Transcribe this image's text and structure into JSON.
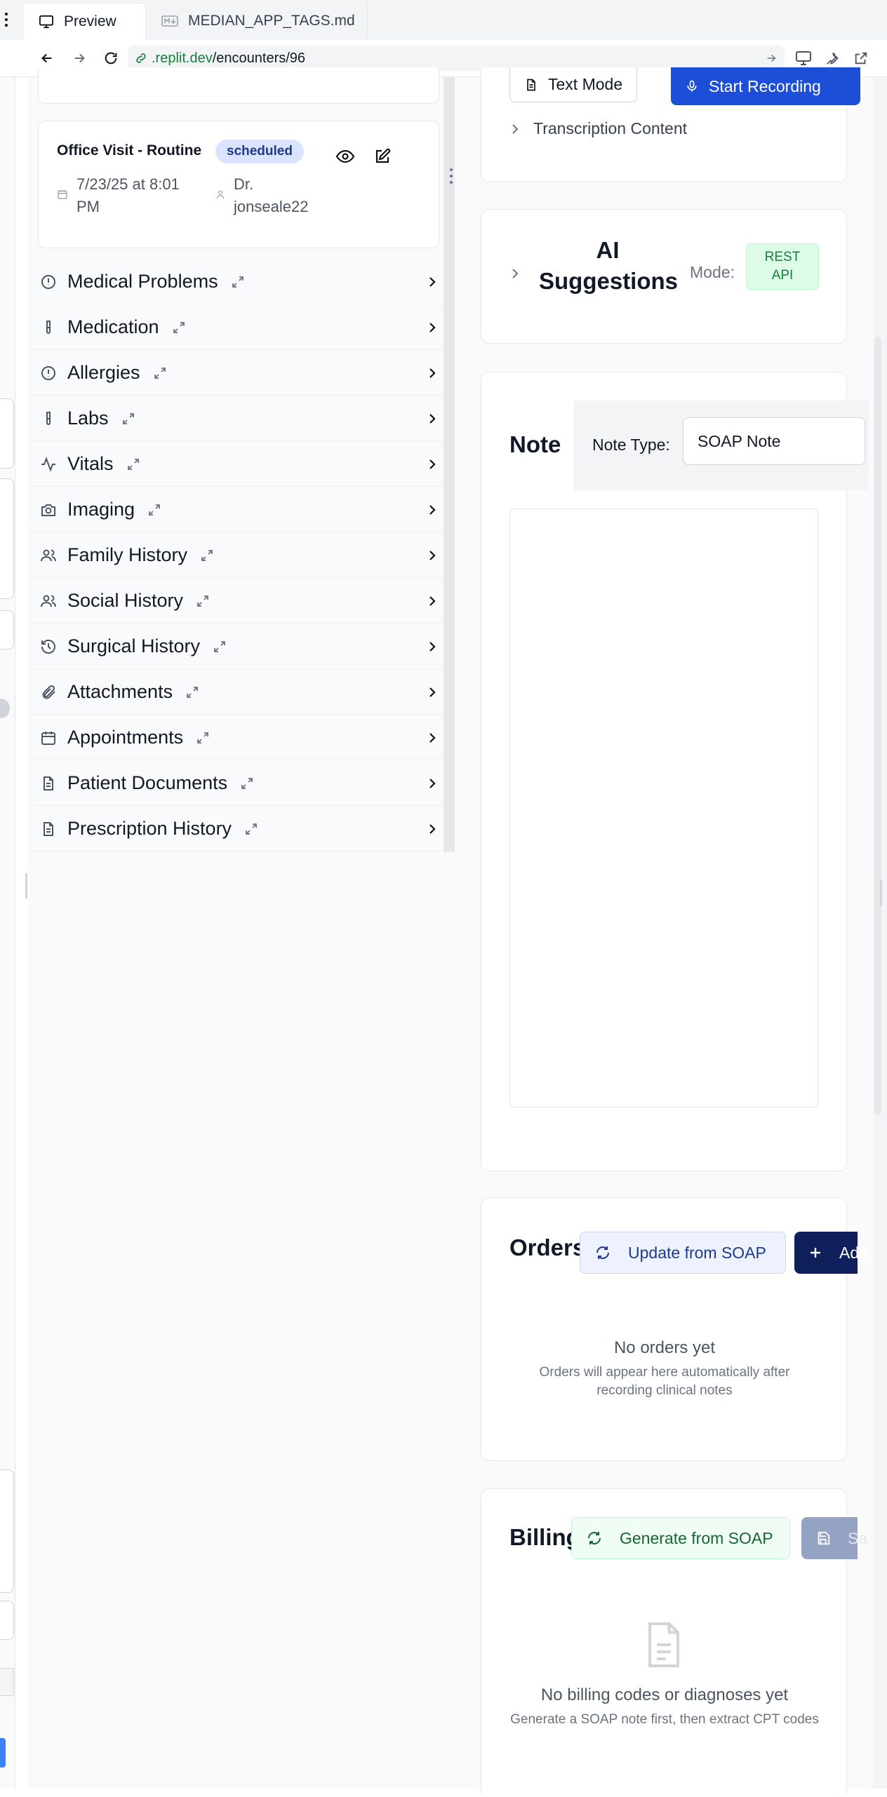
{
  "browser": {
    "tabs": [
      {
        "label": "Preview",
        "icon": "monitor-icon"
      },
      {
        "label": "MEDIAN_APP_TAGS.md",
        "icon": "markdown-icon"
      }
    ],
    "url_domain": ".replit.dev",
    "url_path": "/encounters/96"
  },
  "encounter_card": {
    "title": "Office Visit - Routine",
    "status": "scheduled",
    "date": "7/23/25 at 8:01 PM",
    "provider": "Dr. jonseale22"
  },
  "sidebar": {
    "items": [
      {
        "label": "Medical Problems",
        "icon": "alert-circle-icon"
      },
      {
        "label": "Medication",
        "icon": "test-tube-icon"
      },
      {
        "label": "Allergies",
        "icon": "alert-circle-icon"
      },
      {
        "label": "Labs",
        "icon": "test-tube-icon"
      },
      {
        "label": "Vitals",
        "icon": "activity-icon"
      },
      {
        "label": "Imaging",
        "icon": "camera-icon"
      },
      {
        "label": "Family History",
        "icon": "users-icon"
      },
      {
        "label": "Social History",
        "icon": "users-icon"
      },
      {
        "label": "Surgical History",
        "icon": "history-icon"
      },
      {
        "label": "Attachments",
        "icon": "paperclip-icon"
      },
      {
        "label": "Appointments",
        "icon": "calendar-icon"
      },
      {
        "label": "Patient Documents",
        "icon": "file-icon"
      },
      {
        "label": "Prescription History",
        "icon": "file-icon"
      }
    ]
  },
  "recording": {
    "text_mode_label": "Text Mode",
    "start_recording_label": "Start Recording",
    "transcription_label": "Transcription Content"
  },
  "ai": {
    "title": "AI Suggestions",
    "mode_label": "Mode:",
    "mode_value": "REST API"
  },
  "note": {
    "title": "Note",
    "type_label": "Note Type:",
    "type_value": "SOAP Note"
  },
  "orders": {
    "title": "Orders",
    "update_label": "Update from SOAP",
    "add_label": "Add",
    "empty_title": "No orders yet",
    "empty_desc": "Orders will appear here automatically after recording clinical notes"
  },
  "billing": {
    "title": "Billing",
    "generate_label": "Generate from SOAP",
    "save_label": "Sa",
    "empty_title": "No billing codes or diagnoses yet",
    "empty_desc": "Generate a SOAP note first, then extract CPT codes"
  },
  "colors": {
    "primary_blue": "#1d4ed8",
    "navy": "#0f1f5c",
    "badge_bg": "#dbe4ff",
    "green_badge_bg": "#dcfce7",
    "green_text": "#15803d"
  }
}
